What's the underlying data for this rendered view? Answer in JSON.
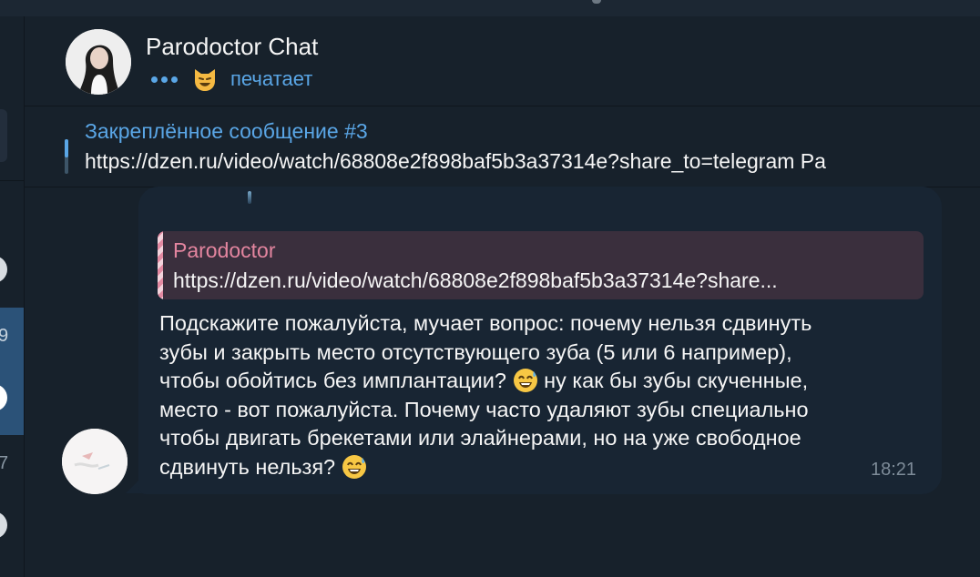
{
  "chat": {
    "title": "Parodoctor Chat",
    "status_emoji": "😼",
    "status_text": "печатает"
  },
  "pinned": {
    "title": "Закреплённое сообщение #3",
    "text": "https://dzen.ru/video/watch/68808e2f898baf5b3a37314e?share_to=telegram Pa"
  },
  "sidebar": {
    "counter_1": "9",
    "counter_2": "7"
  },
  "message": {
    "reply_name": "Parodoctor",
    "reply_text": "https://dzen.ru/video/watch/68808e2f898baf5b3a37314e?share...",
    "part1": "Подскажите пожалуйста, мучает вопрос: почему нельзя сдвинуть\nзубы и закрыть место отсутствующего зуба (5 или 6 например),\nчтобы обойтись без имплантации? ",
    "emoji1": "😅",
    "part2": " ну как бы зубы скученные,\nместо - вот пожалуйста. Почему часто удаляют зубы специально\nчтобы двигать брекетами или элайнерами, но на уже свободное\nсдвинуть нельзя? ",
    "emoji2": "😅",
    "time": "18:21"
  },
  "colors": {
    "accent": "#5aa6e6",
    "background": "#17212b",
    "bubble": "#182533",
    "reply_name": "#e3859f"
  }
}
